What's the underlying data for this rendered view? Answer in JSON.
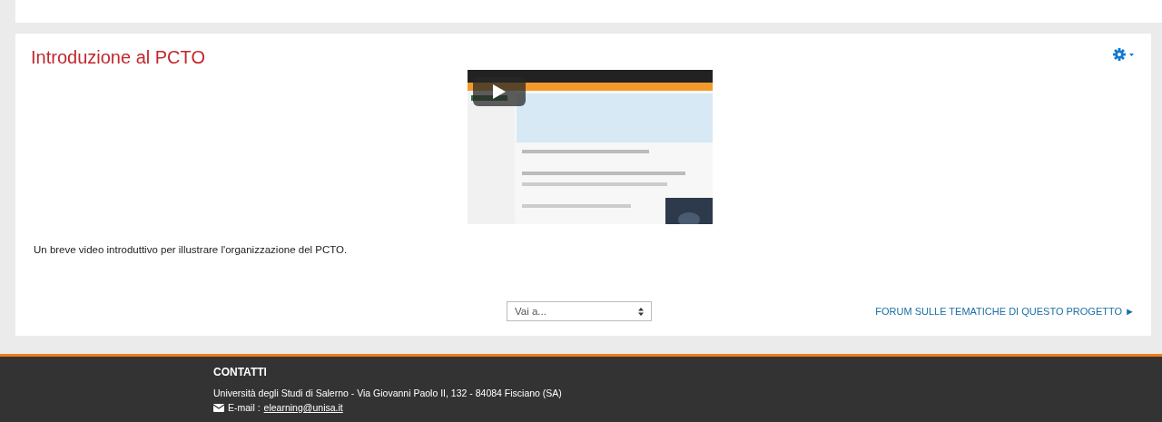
{
  "section": {
    "title": "Introduzione al PCTO",
    "description": "Un breve video introduttivo per illustrare l'organizzazione del PCTO.",
    "jump_select": {
      "value": "Vai a..."
    },
    "forum_link": "FORUM SULLE TEMATICHE DI QUESTO PROGETTO ►"
  },
  "footer": {
    "heading": "CONTATTI",
    "address": "Università degli Studi di Salerno - Via Giovanni Paolo II, 132 - 84084 Fisciano (SA)",
    "email_label": "E-mail :",
    "email": "elearning@unisa.it"
  }
}
